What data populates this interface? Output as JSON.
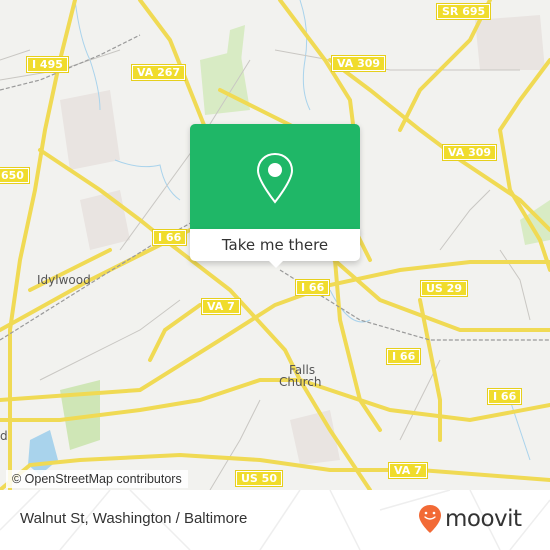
{
  "map": {
    "shields": [
      {
        "label": "I 495",
        "name": "shield-i495"
      },
      {
        "label": "VA 267",
        "name": "shield-va267"
      },
      {
        "label": "SR 695",
        "name": "shield-sr695"
      },
      {
        "label": "VA 309",
        "name": "shield-va309-north"
      },
      {
        "label": "VA 309",
        "name": "shield-va309-east"
      },
      {
        "label": "650",
        "name": "shield-650"
      },
      {
        "label": "I 66",
        "name": "shield-i66-west"
      },
      {
        "label": "I 66",
        "name": "shield-i66-center"
      },
      {
        "label": "US 29",
        "name": "shield-us29"
      },
      {
        "label": "VA 7",
        "name": "shield-va7-west"
      },
      {
        "label": "I 66",
        "name": "shield-i66-east"
      },
      {
        "label": "I 66",
        "name": "shield-i66-far-east"
      },
      {
        "label": "VA 7",
        "name": "shield-va7-south"
      },
      {
        "label": "US 50",
        "name": "shield-us50"
      }
    ],
    "places": [
      {
        "label": "Idylwood",
        "name": "place-idylwood"
      },
      {
        "label": "Falls",
        "name": "place-falls-church-1"
      },
      {
        "label": "Church",
        "name": "place-falls-church-2"
      },
      {
        "label": "d",
        "name": "place-partial-west"
      }
    ],
    "attribution": "© OpenStreetMap contributors",
    "colors": {
      "road": "#f7e26b",
      "land": "#f2f2ef",
      "park": "#d8ebc4",
      "water": "#a9d3ec"
    }
  },
  "popup": {
    "icon": "location-pin-icon",
    "button_label": "Take me there",
    "color": "#1fb767"
  },
  "footer": {
    "title": "Walnut St, Washington / Baltimore",
    "logo_text": "moovit",
    "logo_icon": "moovit-pin-icon",
    "logo_color": "#f26a36"
  }
}
